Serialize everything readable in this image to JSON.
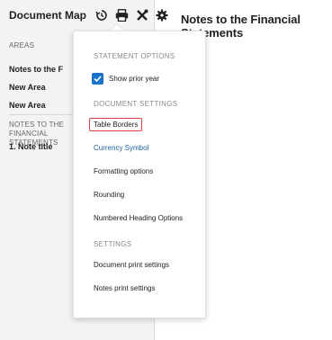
{
  "sidebar": {
    "title": "Document Map",
    "areas_label": "AREAS",
    "areas": [
      "Notes to the Financial Statements",
      "New Area",
      "New Area"
    ],
    "notes_section_label": "NOTES TO THE FINANCIAL STATEMENTS",
    "notes": [
      "1. Note title"
    ]
  },
  "toolbar": {
    "icons": [
      "history-icon",
      "print-icon",
      "tools-icon",
      "gear-icon"
    ]
  },
  "main": {
    "title": "Notes to the Financial Statements",
    "content_fragment": "title"
  },
  "menu": {
    "statement_options_label": "STATEMENT OPTIONS",
    "show_prior_year_label": "Show prior year",
    "show_prior_year_checked": true,
    "document_settings_label": "DOCUMENT SETTINGS",
    "table_borders": "Table Borders",
    "currency_symbol": "Currency Symbol",
    "formatting_options": "Formatting options",
    "rounding": "Rounding",
    "numbered_heading_options": "Numbered Heading Options",
    "settings_label": "SETTINGS",
    "document_print_settings": "Document print settings",
    "notes_print_settings": "Notes print settings"
  },
  "colors": {
    "accent": "#1a73c9",
    "link": "#1c5f9e",
    "highlight": "#e0393e"
  }
}
